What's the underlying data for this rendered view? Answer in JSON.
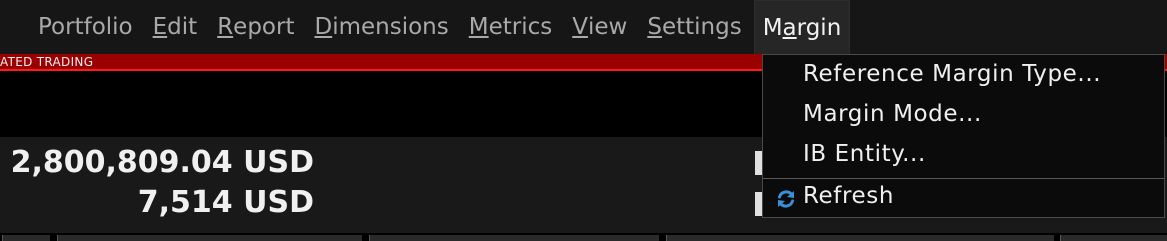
{
  "menubar": {
    "items": [
      {
        "pre": "Portfolio",
        "ul": "",
        "post": ""
      },
      {
        "pre": "",
        "ul": "E",
        "post": "dit"
      },
      {
        "pre": "",
        "ul": "R",
        "post": "eport"
      },
      {
        "pre": "",
        "ul": "D",
        "post": "imensions"
      },
      {
        "pre": "",
        "ul": "M",
        "post": "etrics"
      },
      {
        "pre": "",
        "ul": "V",
        "post": "iew"
      },
      {
        "pre": "",
        "ul": "S",
        "post": "ettings"
      },
      {
        "pre": "M",
        "ul": "a",
        "post": "rgin"
      }
    ]
  },
  "banner": {
    "text": "ATED TRADING",
    "color": "#9a0000",
    "accent": "#ff1a1a"
  },
  "values": {
    "line1": "2,800,809.04 USD",
    "line2": "7,514 USD"
  },
  "dropdown": {
    "items": [
      {
        "label": "Reference Margin Type..."
      },
      {
        "label": "Margin Mode..."
      },
      {
        "label": "IB Entity..."
      },
      {
        "label": "Refresh",
        "icon": "refresh-icon"
      }
    ]
  }
}
